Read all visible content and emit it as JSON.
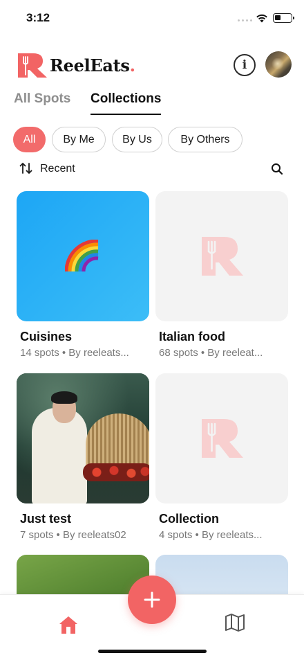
{
  "status_bar": {
    "time": "3:12"
  },
  "app": {
    "name": "ReelEats",
    "name_dot": "."
  },
  "tabs": [
    {
      "label": "All Spots",
      "active": false
    },
    {
      "label": "Collections",
      "active": true
    }
  ],
  "filters": [
    {
      "label": "All",
      "selected": true
    },
    {
      "label": "By Me",
      "selected": false
    },
    {
      "label": "By Us",
      "selected": false
    },
    {
      "label": "By Others",
      "selected": false
    }
  ],
  "sort": {
    "label": "Recent"
  },
  "collections": [
    {
      "title": "Cuisines",
      "meta": "14 spots • By reeleats...",
      "thumb": "rainbow-emoji"
    },
    {
      "title": "Italian food",
      "meta": "68 spots • By reeleat...",
      "thumb": "placeholder-logo"
    },
    {
      "title": "Just test",
      "meta": "7 spots • By reeleats02",
      "thumb": "photo"
    },
    {
      "title": "Collection",
      "meta": "4 spots • By reeleats...",
      "thumb": "placeholder-logo"
    },
    {
      "title": "",
      "meta": "",
      "thumb": "leaves-photo"
    },
    {
      "title": "",
      "meta": "",
      "thumb": "sky-photo"
    }
  ],
  "colors": {
    "accent": "#f26464",
    "chip_selected": "#f26b6b",
    "placeholder_logo": "#f8cfcf",
    "muted_text": "#777777"
  },
  "icons": [
    "wifi-icon",
    "battery-icon",
    "info-icon",
    "sort-icon",
    "search-icon",
    "rainbow-icon",
    "home-icon",
    "plus-icon",
    "map-icon"
  ]
}
